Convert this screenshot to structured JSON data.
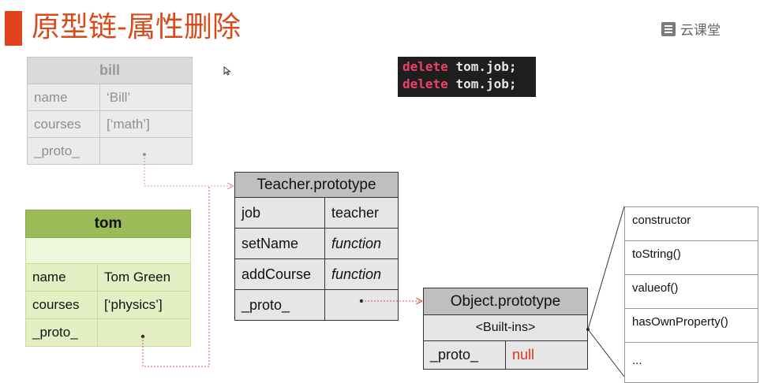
{
  "slide": {
    "title": "原型链-属性删除"
  },
  "logo": {
    "text": "云课堂"
  },
  "code": {
    "lines": [
      {
        "keyword": "delete",
        "rest": "tom.job;"
      },
      {
        "keyword": "delete",
        "rest": "tom.job;"
      }
    ]
  },
  "bill": {
    "header": "bill",
    "rows": [
      {
        "key": "name",
        "value": "‘Bill’"
      },
      {
        "key": "courses",
        "value": "[‘math’]"
      },
      {
        "key": "_proto_",
        "value": ""
      }
    ]
  },
  "tom": {
    "header": "tom",
    "rows": [
      {
        "key": "name",
        "value": "Tom Green"
      },
      {
        "key": "courses",
        "value": "[‘physics’]"
      },
      {
        "key": "_proto_",
        "value": ""
      }
    ]
  },
  "teacher_prototype": {
    "header": "Teacher.prototype",
    "rows": [
      {
        "key": "job",
        "value": "teacher"
      },
      {
        "key": "setName",
        "value": "function"
      },
      {
        "key": "addCourse",
        "value": "function"
      },
      {
        "key": "_proto_",
        "value": ""
      }
    ]
  },
  "object_prototype": {
    "header": "Object.prototype",
    "builtins": "<Built-ins>",
    "proto_key": "_proto_",
    "proto_value": "null"
  },
  "builtins_list": [
    "constructor",
    "toString()",
    "valueof()",
    "hasOwnProperty()",
    "..."
  ],
  "colors": {
    "title_accent": "#e0431e",
    "tom_header": "#9bbb59",
    "arrow": "#d9534f",
    "null_value": "#e0301e"
  }
}
